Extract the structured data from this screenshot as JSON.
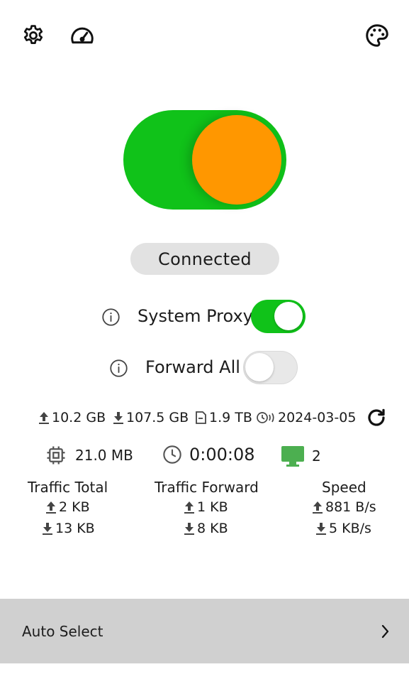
{
  "toolbar": {
    "settings_icon": "gear-icon",
    "dashboard_icon": "speedometer-icon",
    "theme_icon": "palette-icon"
  },
  "colors": {
    "accent_green": "#10c219",
    "knob_orange": "#ff9700",
    "pill_gray": "#e2e2e2",
    "bottom_bar": "#d0d0d0",
    "monitor_green": "#4caf50"
  },
  "status": {
    "label": "Connected"
  },
  "options": {
    "system_proxy": {
      "label": "System Proxy",
      "enabled": true
    },
    "forward_all": {
      "label": "Forward All",
      "enabled": false
    }
  },
  "stats": {
    "upload_total": "10.2 GB",
    "download_total": "107.5 GB",
    "quota": "1.9 TB",
    "reset_date": "2024-03-05",
    "memory": "21.0 MB",
    "uptime": "0:00:08",
    "devices": "2"
  },
  "columns": [
    {
      "title": "Traffic Total",
      "up": "2 KB",
      "down": "13 KB"
    },
    {
      "title": "Traffic Forward",
      "up": "1 KB",
      "down": "8 KB"
    },
    {
      "title": "Speed",
      "up": "881 B/s",
      "down": "5 KB/s"
    }
  ],
  "bottom": {
    "label": "Auto Select"
  }
}
